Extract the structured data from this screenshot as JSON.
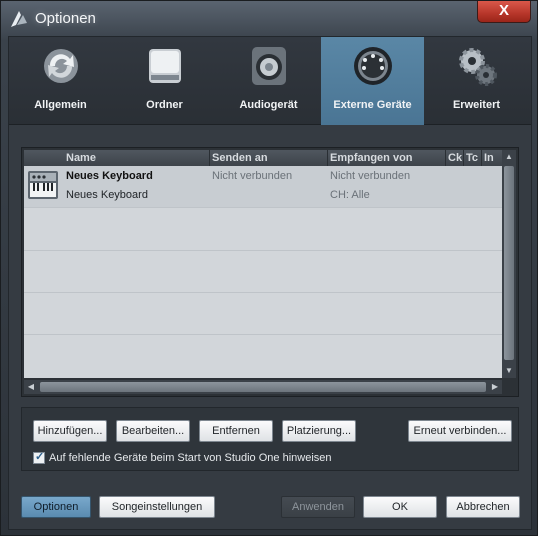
{
  "window": {
    "title": "Optionen",
    "close_label": "X"
  },
  "tabs": [
    {
      "label": "Allgemein",
      "icon": "refresh-arrows-icon"
    },
    {
      "label": "Ordner",
      "icon": "hard-drive-icon"
    },
    {
      "label": "Audiogerät",
      "icon": "speaker-icon"
    },
    {
      "label": "Externe Geräte",
      "icon": "midi-port-icon",
      "active": true
    },
    {
      "label": "Erweitert",
      "icon": "gears-icon"
    }
  ],
  "device_table": {
    "columns": [
      "Name",
      "Senden an",
      "Empfangen von",
      "Ck",
      "Tc",
      "In"
    ],
    "rows": [
      {
        "icon": "keyboard-icon",
        "name": "Neues Keyboard",
        "subname": "Neues Keyboard",
        "send_to": "Nicht verbunden",
        "receive_from": "Nicht verbunden",
        "receive_channel": "CH: Alle"
      }
    ]
  },
  "actions": {
    "add": "Hinzufügen...",
    "edit": "Bearbeiten...",
    "remove": "Entfernen",
    "placement": "Platzierung...",
    "reconnect": "Erneut verbinden...",
    "notify_checkbox": {
      "label": "Auf fehlende Geräte beim Start von Studio One hinweisen",
      "checked": true
    }
  },
  "footer": {
    "options": "Optionen",
    "song_settings": "Songeinstellungen",
    "apply": "Anwenden",
    "ok": "OK",
    "cancel": "Abbrechen"
  },
  "colors": {
    "accent": "#4a7594",
    "background": "#353b42",
    "list_bg": "#d2d6da"
  }
}
